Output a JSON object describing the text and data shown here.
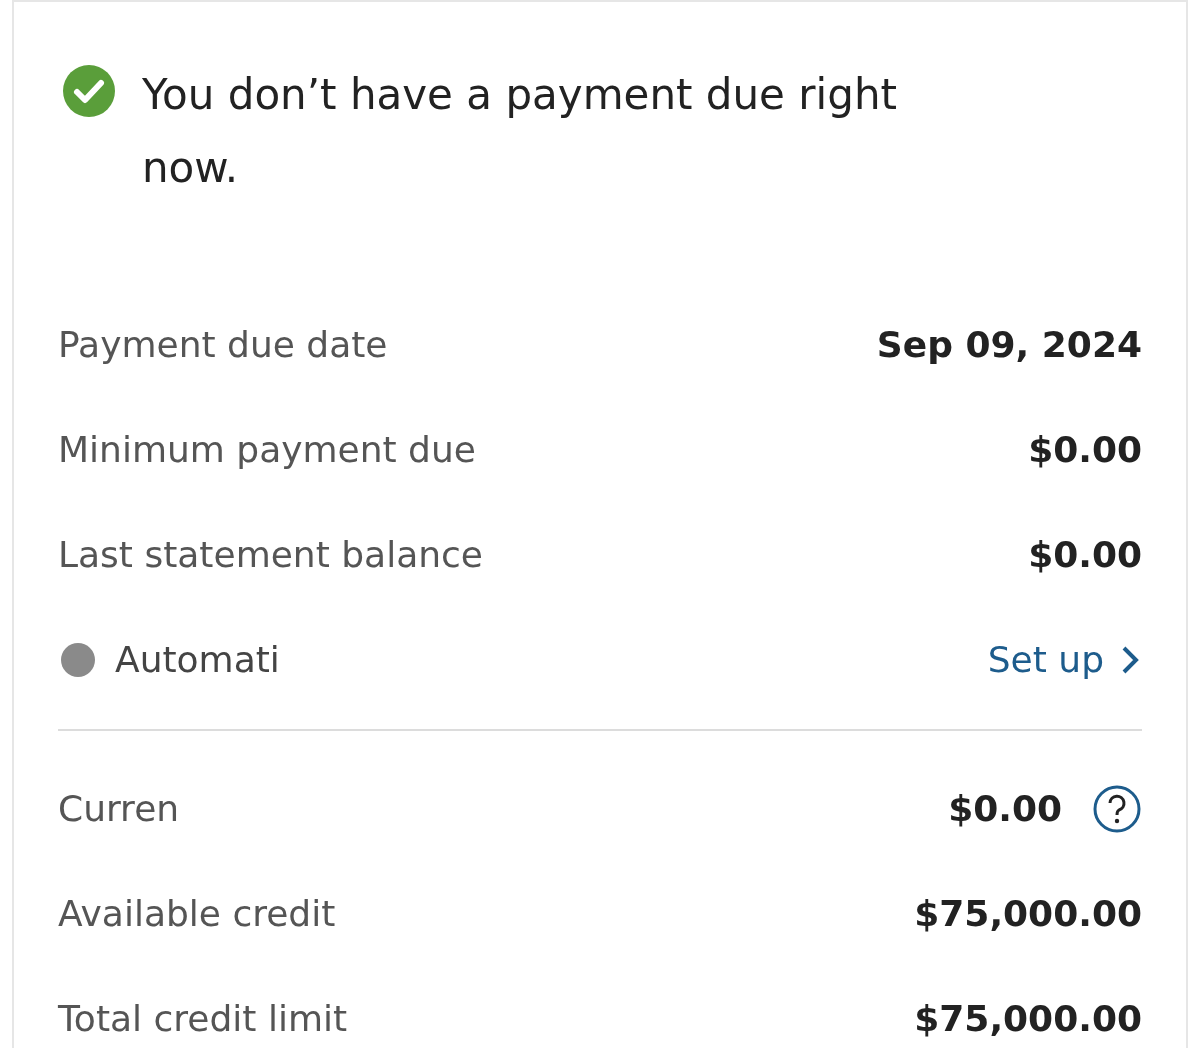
{
  "status": {
    "message": "You don’t have a payment due right now."
  },
  "statement_rows": [
    {
      "label": "Payment due date",
      "value": "Sep 09, 2024"
    },
    {
      "label": "Minimum payment due",
      "value": "$0.00"
    },
    {
      "label": "Last statement balance",
      "value": "$0.00"
    }
  ],
  "autopay": {
    "label": "Automati",
    "link": "Set up"
  },
  "balance_rows": [
    {
      "label": "Curren",
      "value": "$0.00",
      "help": true
    },
    {
      "label": "Available credit",
      "value": "$75,000.00",
      "help": false
    },
    {
      "label": "Total credit limit",
      "value": "$75,000.00",
      "help": false
    }
  ]
}
